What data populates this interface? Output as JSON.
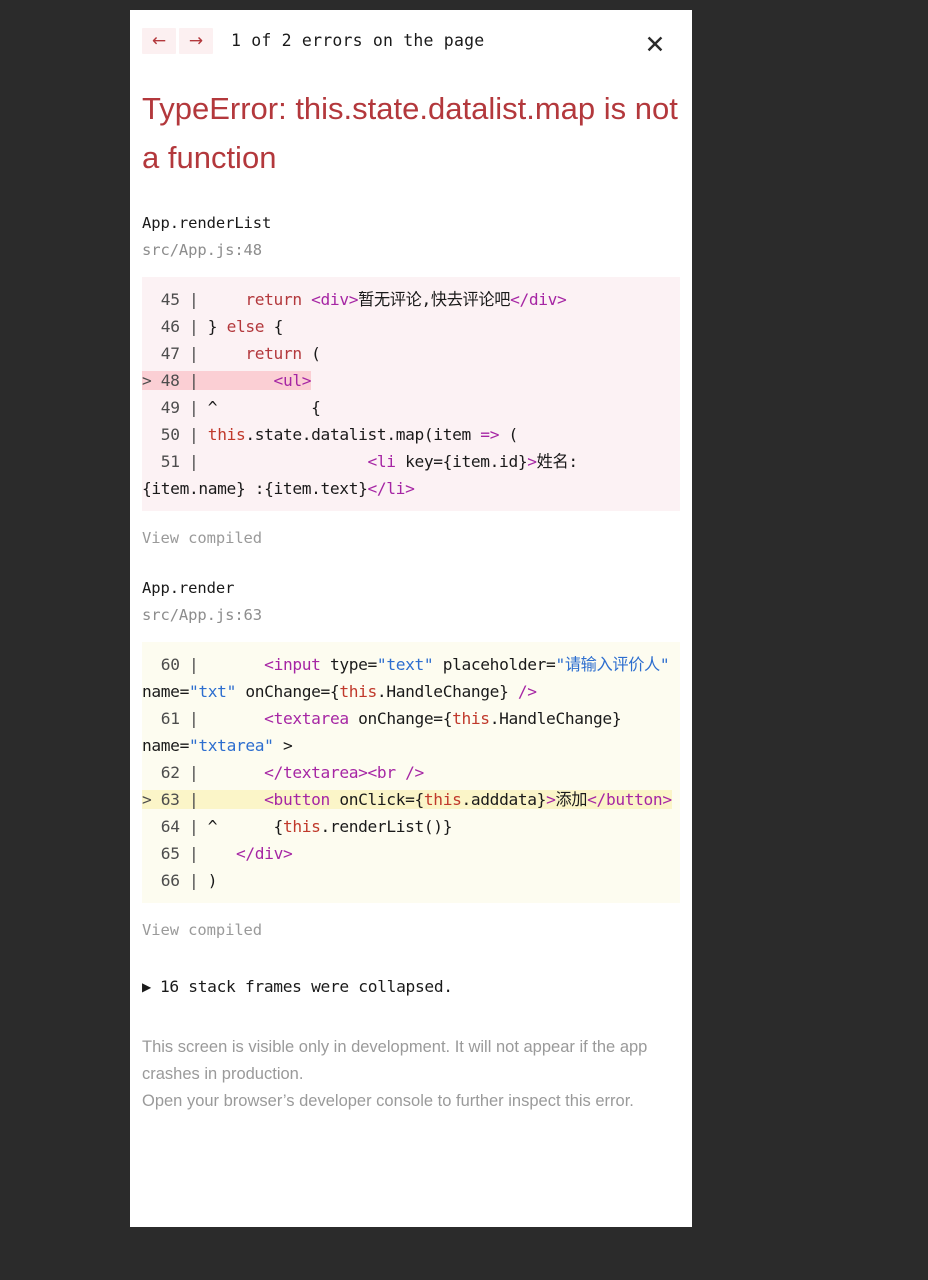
{
  "header": {
    "prev_label": "←",
    "next_label": "→",
    "error_count_text": "1 of 2 errors on the page",
    "close_label": "✕"
  },
  "error": {
    "title": "TypeError: this.state.datalist.map is not a function",
    "accent_color": "#b3383c"
  },
  "frames": [
    {
      "function_name": "App.renderList",
      "location": "src/App.js:48",
      "view_compiled_label": "View compiled",
      "block_style": "pink",
      "lines": [
        {
          "marker": "  ",
          "number": "45",
          "highlight": false,
          "tokens": [
            {
              "text": "     return ",
              "cls": "t-kw"
            },
            {
              "text": "<div>",
              "cls": "t-tag"
            },
            {
              "text": "暂无评论,快去评论吧",
              "cls": "t-plain"
            },
            {
              "text": "</div>",
              "cls": "t-tag"
            }
          ]
        },
        {
          "marker": "  ",
          "number": "46",
          "highlight": false,
          "tokens": [
            {
              "text": " } ",
              "cls": "t-plain"
            },
            {
              "text": "else",
              "cls": "t-kw"
            },
            {
              "text": " {",
              "cls": "t-plain"
            }
          ]
        },
        {
          "marker": "  ",
          "number": "47",
          "highlight": false,
          "tokens": [
            {
              "text": "     return",
              "cls": "t-kw"
            },
            {
              "text": " (",
              "cls": "t-plain"
            }
          ]
        },
        {
          "marker": "> ",
          "number": "48",
          "highlight": true,
          "tokens": [
            {
              "text": "        ",
              "cls": "t-plain"
            },
            {
              "text": "<ul>",
              "cls": "t-tag"
            }
          ]
        },
        {
          "marker": "  ",
          "number": "49",
          "highlight": false,
          "tokens": [
            {
              "text": " ^          {",
              "cls": "t-plain"
            }
          ]
        },
        {
          "marker": "  ",
          "number": "50",
          "highlight": false,
          "tokens": [
            {
              "text": " ",
              "cls": "t-plain"
            },
            {
              "text": "this",
              "cls": "t-this"
            },
            {
              "text": ".state.datalist.map(item ",
              "cls": "t-plain"
            },
            {
              "text": "=>",
              "cls": "t-op"
            },
            {
              "text": " (",
              "cls": "t-plain"
            }
          ]
        },
        {
          "marker": "  ",
          "number": "51",
          "highlight": false,
          "tokens": [
            {
              "text": "                  ",
              "cls": "t-plain"
            },
            {
              "text": "<li",
              "cls": "t-tag"
            },
            {
              "text": " key={item.id}",
              "cls": "t-plain"
            },
            {
              "text": ">",
              "cls": "t-tag"
            },
            {
              "text": "姓名:{item.name} :{item.text}",
              "cls": "t-plain"
            },
            {
              "text": "</li>",
              "cls": "t-tag"
            }
          ]
        }
      ]
    },
    {
      "function_name": "App.render",
      "location": "src/App.js:63",
      "view_compiled_label": "View compiled",
      "block_style": "cream",
      "lines": [
        {
          "marker": "  ",
          "number": "60",
          "highlight": false,
          "tokens": [
            {
              "text": "       ",
              "cls": "t-plain"
            },
            {
              "text": "<input",
              "cls": "t-tag"
            },
            {
              "text": " type=",
              "cls": "t-plain"
            },
            {
              "text": "\"text\"",
              "cls": "t-str"
            },
            {
              "text": " placeholder=",
              "cls": "t-plain"
            },
            {
              "text": "\"请输入评价人\"",
              "cls": "t-str"
            },
            {
              "text": " name=",
              "cls": "t-plain"
            },
            {
              "text": "\"txt\"",
              "cls": "t-str"
            },
            {
              "text": " onChange={",
              "cls": "t-plain"
            },
            {
              "text": "this",
              "cls": "t-this"
            },
            {
              "text": ".HandleChange}",
              "cls": "t-plain"
            },
            {
              "text": " />",
              "cls": "t-tag"
            }
          ]
        },
        {
          "marker": "  ",
          "number": "61",
          "highlight": false,
          "tokens": [
            {
              "text": "       ",
              "cls": "t-plain"
            },
            {
              "text": "<textarea",
              "cls": "t-tag"
            },
            {
              "text": " onChange={",
              "cls": "t-plain"
            },
            {
              "text": "this",
              "cls": "t-this"
            },
            {
              "text": ".HandleChange}",
              "cls": "t-plain"
            },
            {
              "text": " name=",
              "cls": "t-plain"
            },
            {
              "text": "\"txtarea\"",
              "cls": "t-str"
            },
            {
              "text": " >",
              "cls": "t-plain"
            }
          ]
        },
        {
          "marker": "  ",
          "number": "62",
          "highlight": false,
          "tokens": [
            {
              "text": "       ",
              "cls": "t-plain"
            },
            {
              "text": "</textarea><br />",
              "cls": "t-tag"
            }
          ]
        },
        {
          "marker": "> ",
          "number": "63",
          "highlight": true,
          "tokens": [
            {
              "text": "       ",
              "cls": "t-plain"
            },
            {
              "text": "<button",
              "cls": "t-tag"
            },
            {
              "text": " onClick={",
              "cls": "t-plain"
            },
            {
              "text": "this",
              "cls": "t-this"
            },
            {
              "text": ".adddata}",
              "cls": "t-plain"
            },
            {
              "text": ">",
              "cls": "t-tag"
            },
            {
              "text": "添加",
              "cls": "t-plain"
            },
            {
              "text": "</button>",
              "cls": "t-tag"
            }
          ]
        },
        {
          "marker": "  ",
          "number": "64",
          "highlight": false,
          "tokens": [
            {
              "text": " ^      {",
              "cls": "t-plain"
            },
            {
              "text": "this",
              "cls": "t-this"
            },
            {
              "text": ".renderList()}",
              "cls": "t-plain"
            }
          ]
        },
        {
          "marker": "  ",
          "number": "65",
          "highlight": false,
          "tokens": [
            {
              "text": "    ",
              "cls": "t-plain"
            },
            {
              "text": "</div>",
              "cls": "t-tag"
            }
          ]
        },
        {
          "marker": "  ",
          "number": "66",
          "highlight": false,
          "tokens": [
            {
              "text": " )",
              "cls": "t-plain"
            }
          ]
        }
      ]
    }
  ],
  "collapsed": {
    "triangle": "▶",
    "label": "16 stack frames were collapsed."
  },
  "footer": {
    "line1": "This screen is visible only in development. It will not appear if the app crashes in production.",
    "line2": "Open your browser’s developer console to further inspect this error."
  }
}
